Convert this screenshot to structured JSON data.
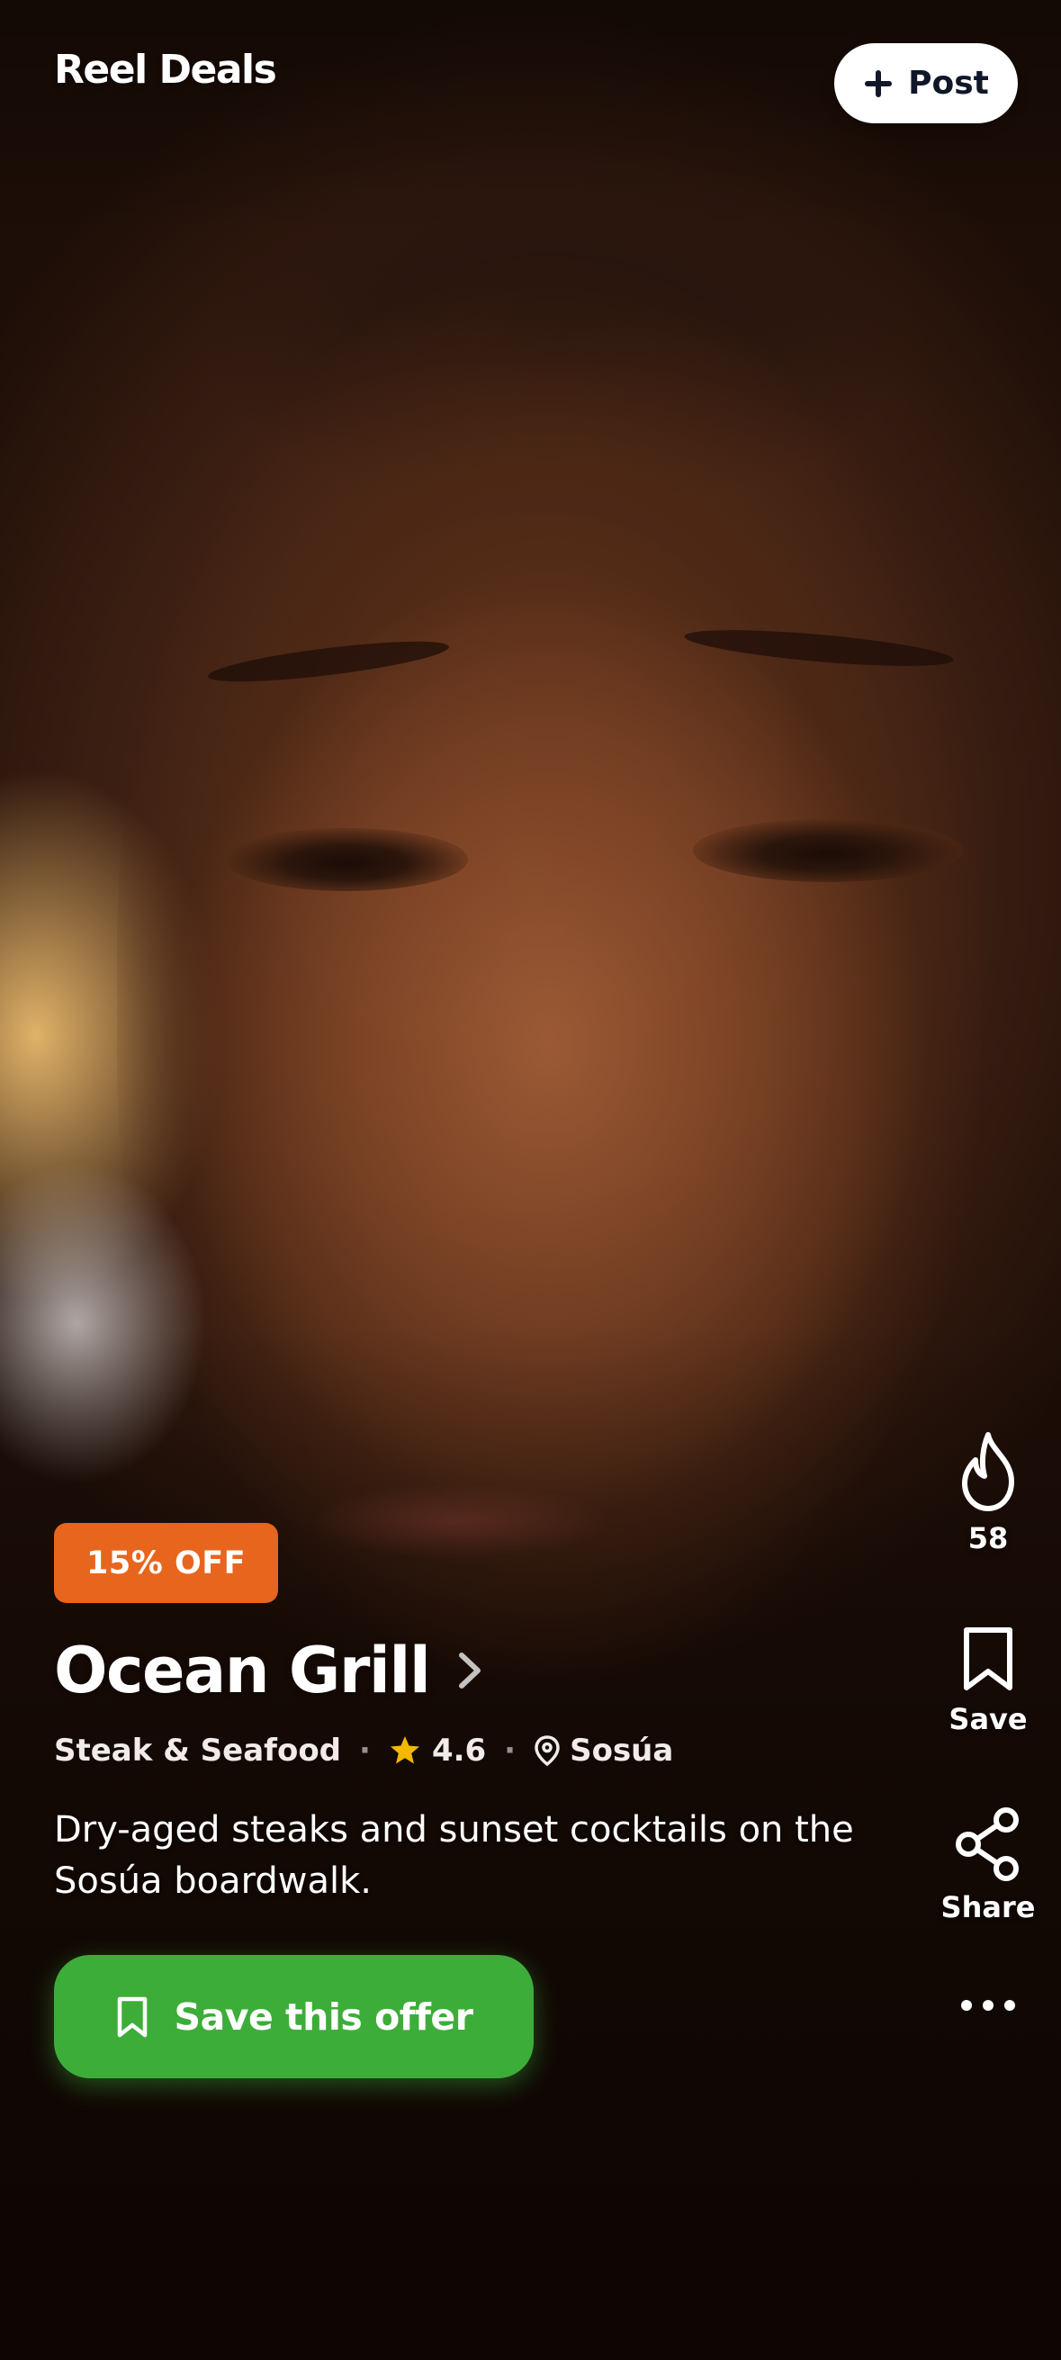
{
  "header": {
    "brand": "Reel Deals",
    "post_label": "Post"
  },
  "rail": {
    "fire_count": "58",
    "save_label": "Save",
    "share_label": "Share"
  },
  "offer": {
    "badge": "15% OFF",
    "restaurant_name": "Ocean Grill",
    "category": "Steak & Seafood",
    "rating": "4.6",
    "location": "Sosúa",
    "description": "Dry-aged steaks and sunset cocktails on the Sosúa boardwalk.",
    "cta_label": "Save this offer"
  },
  "colors": {
    "badge_bg": "#e8651e",
    "cta_bg": "#3dad39",
    "star": "#f5b800",
    "post_text": "#0f1729"
  },
  "icons": [
    "plus-icon",
    "fire-icon",
    "bookmark-icon",
    "share-icon",
    "more-icon",
    "chevron-right-icon",
    "star-icon",
    "location-pin-icon"
  ]
}
